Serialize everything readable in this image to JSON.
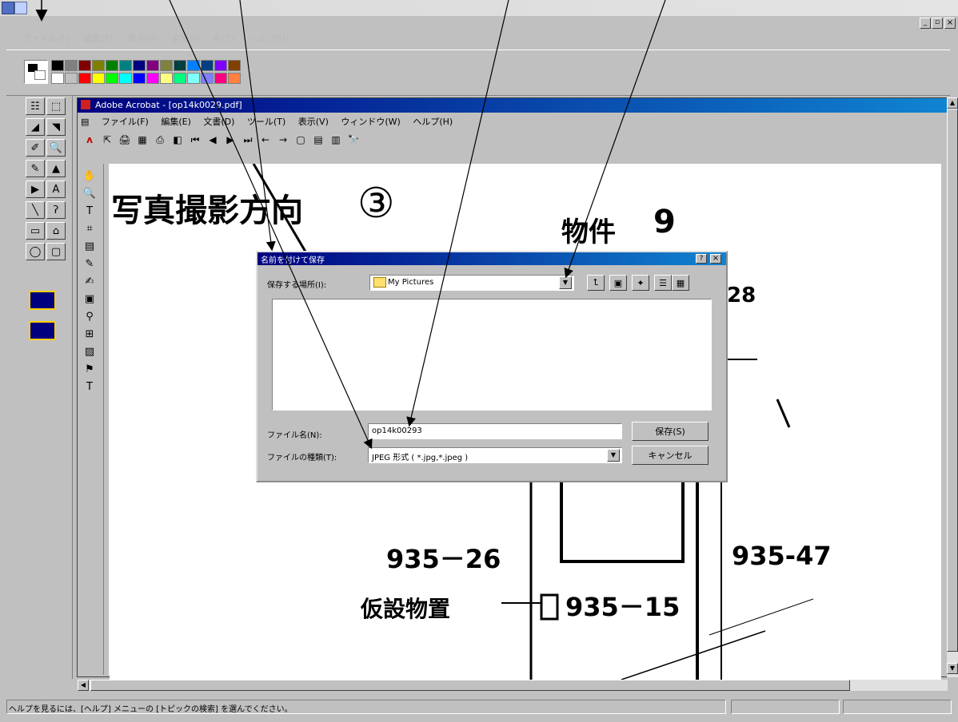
{
  "paint": {
    "title": "",
    "menu": [
      "ファイル(F)",
      "編集(E)",
      "表示(V)",
      "変形(I)",
      "色(C)",
      "ヘルプ(H)"
    ],
    "status_text": "ヘルプを見るには、[ヘルプ] メニューの [トピックの検索] を選んでください。",
    "palette_top": [
      "#000000",
      "#808080",
      "#800000",
      "#808000",
      "#008000",
      "#008080",
      "#000080",
      "#800080",
      "#808040",
      "#004040",
      "#0080ff",
      "#004080",
      "#8000ff",
      "#804000"
    ],
    "palette_bottom": [
      "#ffffff",
      "#c0c0c0",
      "#ff0000",
      "#ffff00",
      "#00ff00",
      "#00ffff",
      "#0000ff",
      "#ff00ff",
      "#ffff80",
      "#00ff80",
      "#80ffff",
      "#8080ff",
      "#ff0080",
      "#ff8040"
    ],
    "tools": [
      "☷",
      "⬚",
      "◢",
      "◥",
      "✐",
      "🔍",
      "✎",
      "▲",
      "▶",
      "A",
      "╲",
      "ʔ",
      "▭",
      "⌂",
      "◯",
      "▢"
    ]
  },
  "acrobat": {
    "title": "Adobe Acrobat - [op14k0029.pdf]",
    "menu": [
      "ファイル(F)",
      "編集(E)",
      "文書(D)",
      "ツール(T)",
      "表示(V)",
      "ウィンドウ(W)",
      "ヘルプ(H)"
    ],
    "toolbar_icons": [
      "⇱",
      "🖨",
      "▦",
      "⎙",
      "◧",
      "⏮",
      "◀",
      "▶",
      "⏭",
      "←",
      "→",
      "▢",
      "▤",
      "▥",
      "🔭"
    ],
    "left_tools": [
      "✋",
      "🔍",
      "T",
      "⌗",
      "▤",
      "✎",
      "✍",
      "▣",
      "⚲",
      "⊞",
      "▨",
      "⚑",
      "T"
    ]
  },
  "document": {
    "heading": "写真撮影方向",
    "circled_num": "③",
    "property": "物件",
    "property_num": "9",
    "lot_28": "28",
    "lot_26": "935－26",
    "lot_47": "935-47",
    "lot_15": "935－15",
    "temp_building": "仮設物置"
  },
  "dialog": {
    "title": "名前を付けて保存",
    "save_in_label": "保存する場所(I):",
    "save_in_value": "My Pictures",
    "filename_label": "ファイル名(N):",
    "filename_value": "op14k00293",
    "filetype_label": "ファイルの種類(T):",
    "filetype_value": "JPEG 形式 ( *.jpg,*.jpeg )",
    "save_button": "保存(S)",
    "cancel_button": "キャンセル",
    "help_glyph": "?",
    "close_glyph": "×"
  },
  "window_controls": {
    "minimize": "_",
    "restore": "▫",
    "close": "×"
  }
}
